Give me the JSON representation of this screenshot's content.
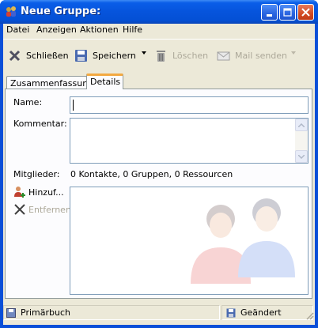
{
  "window": {
    "title": "Neue Gruppe:",
    "icons": [
      "group-icon",
      "minimize-icon",
      "maximize-icon",
      "close-icon"
    ]
  },
  "menu": {
    "items": [
      {
        "label": "Datei",
        "access_key": "D"
      },
      {
        "label": "Anzeigen",
        "access_key": "A"
      },
      {
        "label": "Aktionen",
        "access_key": "k"
      },
      {
        "label": "Hilfe",
        "access_key": "H"
      }
    ]
  },
  "toolbar": {
    "close_label": "Schließen",
    "save_label": "Speichern",
    "delete_label": "Löschen",
    "mail_label": "Mail senden"
  },
  "tabs": [
    {
      "label": "Zusammenfassung",
      "active": false
    },
    {
      "label": "Details",
      "active": true
    }
  ],
  "details": {
    "name_label": "Name:",
    "name_value": "",
    "comment_label": "Kommentar:",
    "comment_value": "",
    "members_label": "Mitglieder:",
    "members_summary": "0 Kontakte, 0 Gruppen, 0 Ressourcen",
    "add_label": "Hinzuf...",
    "remove_label": "Entfernen"
  },
  "status": {
    "addressbook": "Primärbuch",
    "state": "Geändert"
  },
  "colors": {
    "titlebar": "#0654dc",
    "face": "#ece9d8",
    "tab_accent": "#f3a941",
    "field_border": "#7f9db9",
    "disabled_text": "#aca899"
  }
}
